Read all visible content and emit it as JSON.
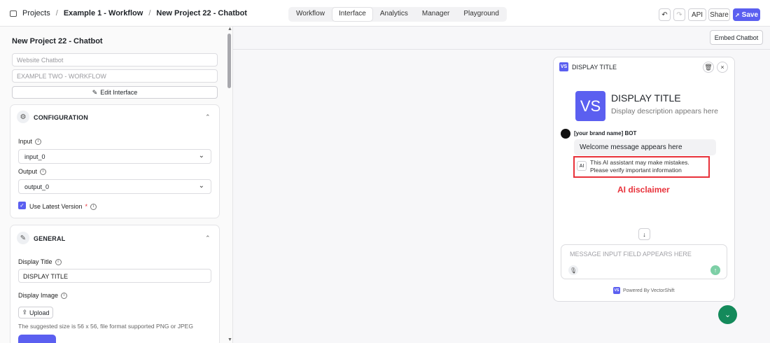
{
  "breadcrumb": {
    "items": [
      "Projects",
      "Example 1 - Workflow",
      "New Project 22 - Chatbot"
    ]
  },
  "tabs": [
    "Workflow",
    "Interface",
    "Analytics",
    "Manager",
    "Playground"
  ],
  "active_tab": "Interface",
  "toolbar": {
    "undo": "↶",
    "redo": "↷",
    "api": "API",
    "share": "Share",
    "save": "Save"
  },
  "left": {
    "project_title": "New Project 22 - Chatbot",
    "name_placeholder": "Website Chatbot",
    "workflow_placeholder": "EXAMPLE TWO - WORKFLOW",
    "edit_interface": "Edit Interface",
    "config": {
      "header": "CONFIGURATION",
      "input_label": "Input",
      "input_value": "input_0",
      "output_label": "Output",
      "output_value": "output_0",
      "latest_version_label": "Use Latest Version",
      "required_mark": "*"
    },
    "general": {
      "header": "GENERAL",
      "display_title_label": "Display Title",
      "display_title_value": "DISPLAY TITLE",
      "display_image_label": "Display Image",
      "upload": "Upload",
      "hint": "The suggested size is 56 x 56, file format supported PNG or JPEG"
    }
  },
  "main": {
    "embed": "Embed Chatbot"
  },
  "widget": {
    "header_title": "DISPLAY TITLE",
    "logo_text": "VS",
    "big_title": "DISPLAY TITLE",
    "description": "Display description appears here",
    "bot_name": "[your brand name] BOT",
    "welcome": "Welcome message appears here",
    "ai_badge": "AI",
    "disclaimer": "This AI assistant may make mistakes. Please verify important information",
    "input_placeholder": "MESSAGE INPUT FIELD APPEARS HERE",
    "powered_by": "Powered By VectorShift"
  },
  "annotation": "AI disclaimer",
  "colors": {
    "accent": "#5b5ff0",
    "annotation": "#e8313a",
    "fab": "#148a5b"
  }
}
